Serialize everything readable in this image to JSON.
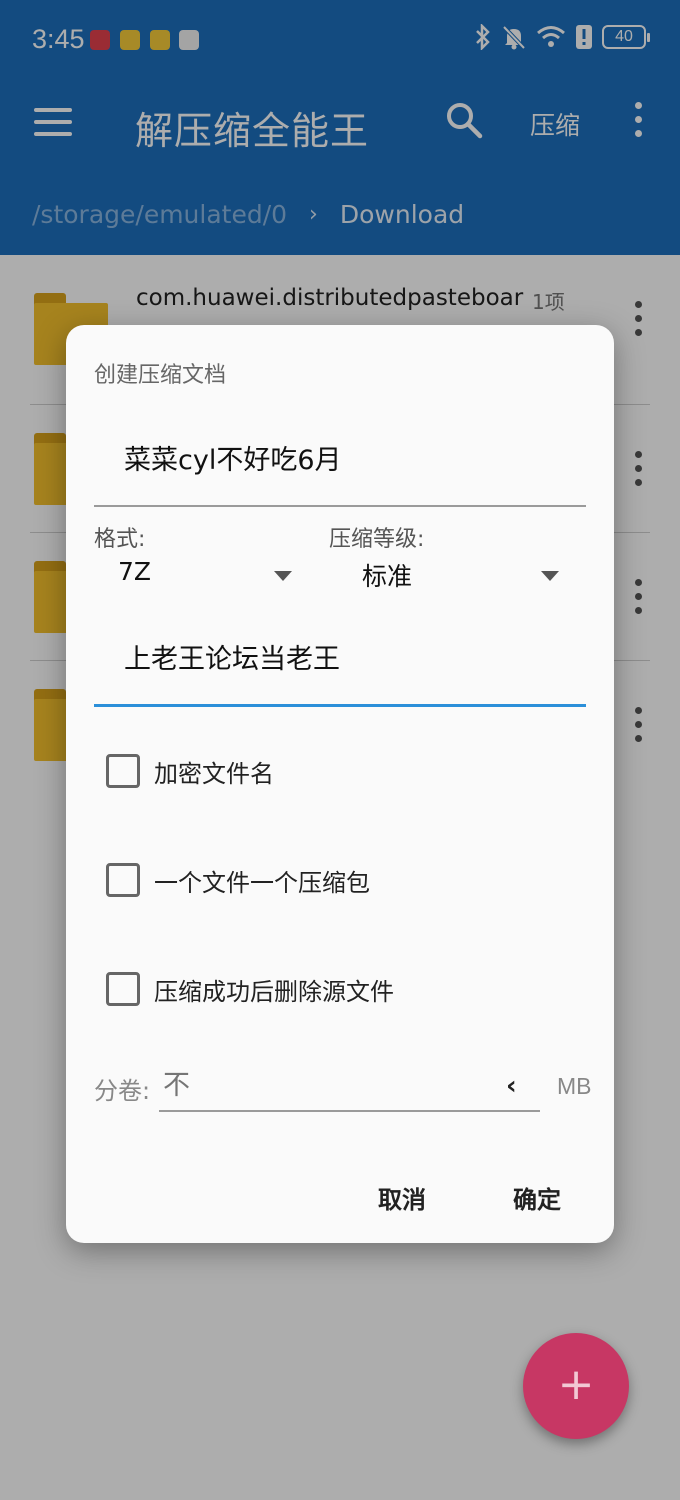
{
  "status_bar": {
    "time": "3:45",
    "battery": "40"
  },
  "app": {
    "title": "解压缩全能王",
    "compress_action": "压缩"
  },
  "breadcrumb": {
    "root": "/storage/emulated/0",
    "current": "Download"
  },
  "file_list": [
    {
      "name": "com.huawei.distributedpasteboar",
      "count": "1项"
    }
  ],
  "dialog": {
    "title": "创建压缩文档",
    "archive_name": "菜菜cyl不好吃6月",
    "format_label": "格式:",
    "format_value": "7Z",
    "level_label": "压缩等级:",
    "level_value": "标准",
    "password": "上老王论坛当老王",
    "options": [
      {
        "label": "加密文件名",
        "checked": false
      },
      {
        "label": "一个文件一个压缩包",
        "checked": false
      },
      {
        "label": "压缩成功后删除源文件",
        "checked": false
      }
    ],
    "volume_label": "分卷:",
    "volume_placeholder": "不",
    "volume_unit": "MB",
    "cancel": "取消",
    "confirm": "确定"
  },
  "colors": {
    "primary": "#1c6fbd",
    "accent": "#2b8fd9",
    "fab": "#c73764",
    "folder": "#f5c12d"
  },
  "fab": {
    "icon": "plus-icon"
  }
}
